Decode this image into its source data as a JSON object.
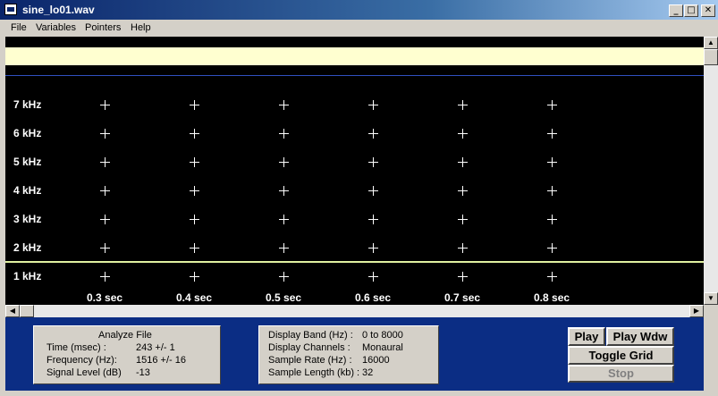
{
  "window": {
    "title": "sine_lo01.wav",
    "controls": [
      "_",
      "□",
      "✕"
    ]
  },
  "menu": [
    "File",
    "Variables",
    "Pointers",
    "Help"
  ],
  "grid": {
    "y_labels": [
      "7  kHz",
      "6  kHz",
      "5  kHz",
      "4  kHz",
      "3  kHz",
      "2  kHz",
      "1  kHz"
    ],
    "x_labels": [
      "0.3 sec",
      "0.4 sec",
      "0.5 sec",
      "0.6 sec",
      "0.7 sec",
      "0.8 sec"
    ],
    "colors": {
      "background": "#000000",
      "highlight_band": "#ffffd0",
      "marker_line": "#e0f0a0",
      "divider": "#3050c0"
    }
  },
  "scroll_icons": {
    "up": "▲",
    "down": "▼",
    "left": "◀",
    "right": "▶"
  },
  "analyze": {
    "title": "Analyze File",
    "rows": [
      {
        "label": "Time (msec) :",
        "value": "243  +/- 1"
      },
      {
        "label": "Frequency (Hz):",
        "value": "1516 +/- 16"
      },
      {
        "label": "Signal Level (dB)",
        "value": "-13"
      }
    ]
  },
  "display": {
    "rows": [
      {
        "label": "Display Band (Hz) :",
        "value": "0 to 8000"
      },
      {
        "label": "Display Channels :",
        "value": "Monaural"
      },
      {
        "label": "Sample Rate (Hz) :",
        "value": "16000"
      },
      {
        "label": "Sample Length (kb) :",
        "value": "32"
      }
    ]
  },
  "buttons": {
    "play": "Play",
    "play_wdw": "Play Wdw",
    "toggle_grid": "Toggle Grid",
    "stop": "Stop"
  }
}
